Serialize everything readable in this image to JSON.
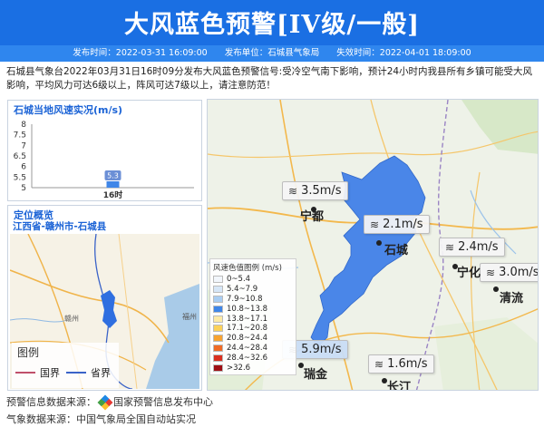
{
  "header": {
    "title": "大风蓝色预警[IV级/一般]",
    "publish_time": "发布时间：2022-03-31 16:09:00",
    "publisher": "发布单位：石城县气象局",
    "expire_time": "失效时间：2022-04-01 18:09:00"
  },
  "description": "石城县气象台2022年03月31日16时09分发布大风蓝色预警信号:受冷空气南下影响，预计24小时内我县所有乡镇可能受大风影响，平均风力可达6级以上，阵风可达7级以上，请注意防范！",
  "wind_chart": {
    "title": "石城当地风速实况(m/s)",
    "chart_data": {
      "type": "bar",
      "categories": [
        "16时"
      ],
      "values": [
        5.3
      ],
      "data_labels": [
        "5.3"
      ],
      "yticks": [
        "8",
        "7.5",
        "7",
        "6.5",
        "6",
        "5.5",
        "5"
      ],
      "ylim": [
        5,
        8
      ],
      "xlabel": "",
      "ylabel": ""
    }
  },
  "location": {
    "title": "定位概览",
    "path": "江西省-赣州市-石城县",
    "map_labels": [
      "赣州",
      "福州"
    ],
    "legend_title": "图例",
    "legend_items": [
      {
        "label": "国界",
        "color": "#c0506a"
      },
      {
        "label": "省界",
        "color": "#3a63c8"
      }
    ]
  },
  "map": {
    "wind_labels": [
      {
        "value": "3.5m/s"
      },
      {
        "value": "2.1m/s"
      },
      {
        "value": "2.4m/s"
      },
      {
        "value": "3.0m/s"
      },
      {
        "value": "5.9m/s"
      },
      {
        "value": "1.6m/s"
      }
    ],
    "cities": [
      "宁都",
      "石城",
      "宁化",
      "清流",
      "瑞金",
      "长汀"
    ],
    "legend": {
      "title": "风速色值图例 (m/s)",
      "items": [
        {
          "label": "0~5.4",
          "color": "#f2f6fc"
        },
        {
          "label": "5.4~7.9",
          "color": "#d6e6f7"
        },
        {
          "label": "7.9~10.8",
          "color": "#a9cdf2"
        },
        {
          "label": "10.8~13.8",
          "color": "#3f86e8"
        },
        {
          "label": "13.8~17.1",
          "color": "#fdeaa6"
        },
        {
          "label": "17.1~20.8",
          "color": "#fbd15a"
        },
        {
          "label": "20.8~24.4",
          "color": "#f7a331"
        },
        {
          "label": "24.4~28.4",
          "color": "#ef6b25"
        },
        {
          "label": "28.4~32.6",
          "color": "#d9301f"
        },
        {
          "label": ">32.6",
          "color": "#9e0f14"
        }
      ]
    }
  },
  "sources": {
    "warning_source": "预警信息数据来源：",
    "warning_source_name": "国家预警信息发布中心",
    "weather_source": "气象数据来源：中国气象局全国自动站实况"
  },
  "colors": {
    "header_bg": "#1a6fe3",
    "meta_bg": "#2f86ee",
    "county_fill": "#4a86e8",
    "accent_text": "#1b63d6"
  }
}
